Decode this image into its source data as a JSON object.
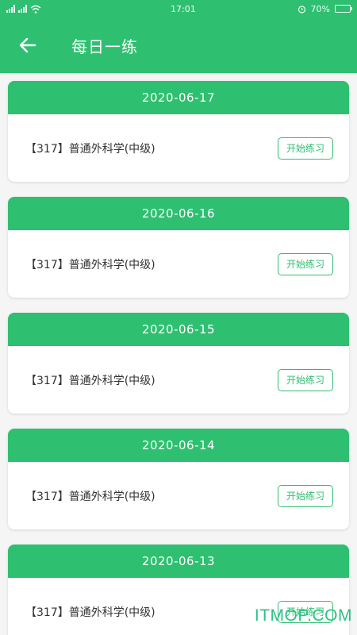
{
  "status_bar": {
    "time": "17:01",
    "battery_text": "70%",
    "battery_level": 0.7
  },
  "app_bar": {
    "title": "每日一练",
    "back_icon": "arrow-left-icon"
  },
  "colors": {
    "primary": "#2fbf71",
    "background": "#f4f5f4",
    "text": "#333333"
  },
  "cards": [
    {
      "date": "2020-06-17",
      "course": "【317】普通外科学(中级)",
      "button": "开始练习"
    },
    {
      "date": "2020-06-16",
      "course": "【317】普通外科学(中级)",
      "button": "开始练习"
    },
    {
      "date": "2020-06-15",
      "course": "【317】普通外科学(中级)",
      "button": "开始练习"
    },
    {
      "date": "2020-06-14",
      "course": "【317】普通外科学(中级)",
      "button": "开始练习"
    },
    {
      "date": "2020-06-13",
      "course": "【317】普通外科学(中级)",
      "button": "开始练习"
    }
  ],
  "watermark": "ITMOP.COM"
}
